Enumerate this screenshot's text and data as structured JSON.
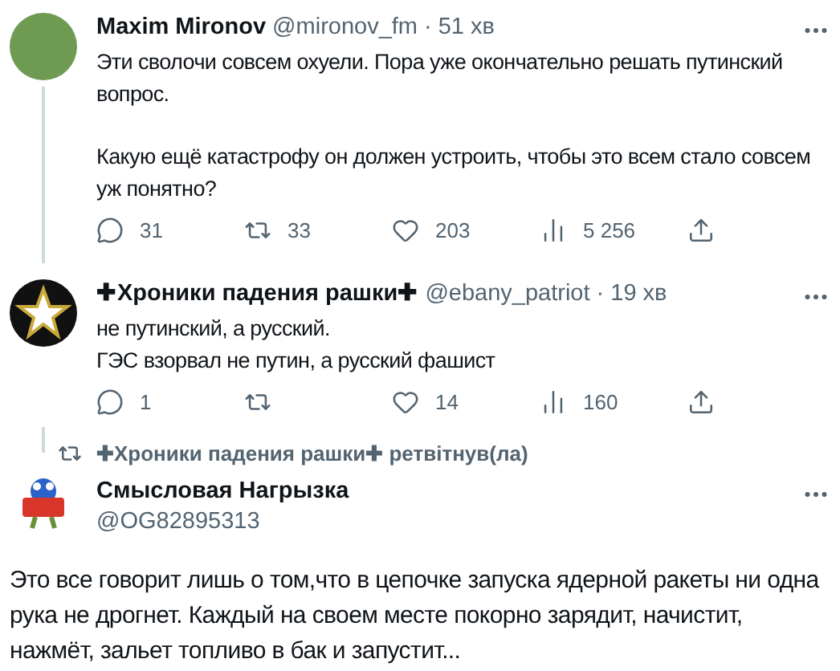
{
  "tweets": [
    {
      "kind": "reply_thread",
      "author": {
        "name": "Maxim Mironov",
        "handle": "@mironov_fm",
        "time": "· 51 хв",
        "avatar": {
          "kind": "photo"
        }
      },
      "paragraphs": [
        "Эти сволочи совсем охуели. Пора уже окончательно решать путинский вопрос.",
        "Какую ещё катастрофу он должен устроить, чтобы это всем стало совсем уж понятно?"
      ],
      "actions": [
        {
          "kind": "reply",
          "count": "31"
        },
        {
          "kind": "retweet",
          "count": "33"
        },
        {
          "kind": "like",
          "count": "203"
        },
        {
          "kind": "views",
          "count": "5 256"
        },
        {
          "kind": "share"
        }
      ]
    },
    {
      "kind": "reply",
      "author": {
        "name": "✚Хроники падения рашки✚",
        "handle": "@ebany_patriot",
        "time": "· 19 хв",
        "avatar": {
          "kind": "star"
        }
      },
      "paragraphs": [
        "не путинский, а русский.\nГЭС взорвал не путин, а русский фашист"
      ],
      "actions": [
        {
          "kind": "reply",
          "count": "1"
        },
        {
          "kind": "retweet"
        },
        {
          "kind": "like",
          "count": "14"
        },
        {
          "kind": "views",
          "count": "160"
        },
        {
          "kind": "share"
        }
      ]
    },
    {
      "kind": "retweeted",
      "retweeted_by": "✚Хроники падения рашки✚ ретвітнув(ла)",
      "author": {
        "name": "Смысловая Нагрызка",
        "handle": "@OG82895313",
        "avatar": {
          "kind": "sign"
        }
      },
      "paragraphs": [
        "Это все говорит лишь о том,что в цепочке запуска ядерной ракеты ни одна рука не дрогнет. Каждый на своем месте покорно зарядит, начистит, нажмёт, зальет топливо в бак и запустит..."
      ]
    }
  ]
}
